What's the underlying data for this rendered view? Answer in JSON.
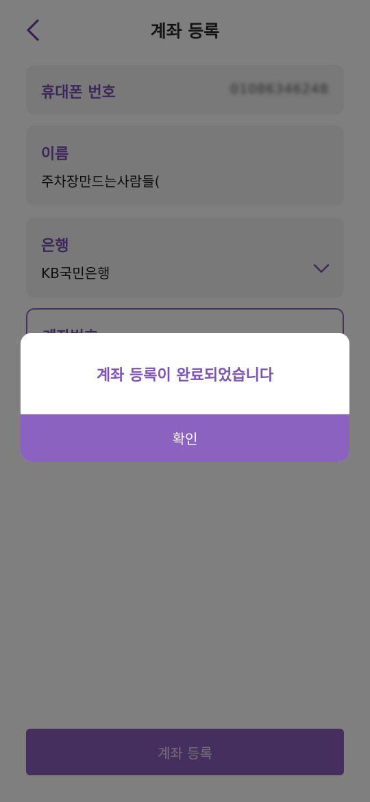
{
  "header": {
    "title": "계좌 등록",
    "back_icon": "chevron-left-icon"
  },
  "fields": {
    "phone": {
      "label": "휴대폰 번호",
      "value": "01086346248"
    },
    "name": {
      "label": "이름",
      "value": "주차장만드는사람들("
    },
    "bank": {
      "label": "은행",
      "value": "KB국민은행",
      "icon": "chevron-down-icon"
    },
    "account": {
      "label": "계좌번호"
    }
  },
  "submit": {
    "label": "계좌 등록"
  },
  "dialog": {
    "message": "계좌 등록이 완료되었습니다",
    "confirm_label": "확인"
  },
  "colors": {
    "accent": "#8c62c0",
    "label": "#7b4fb0",
    "field_bg": "#f2f2f4",
    "overlay": "rgba(0,0,0,0.5)"
  }
}
